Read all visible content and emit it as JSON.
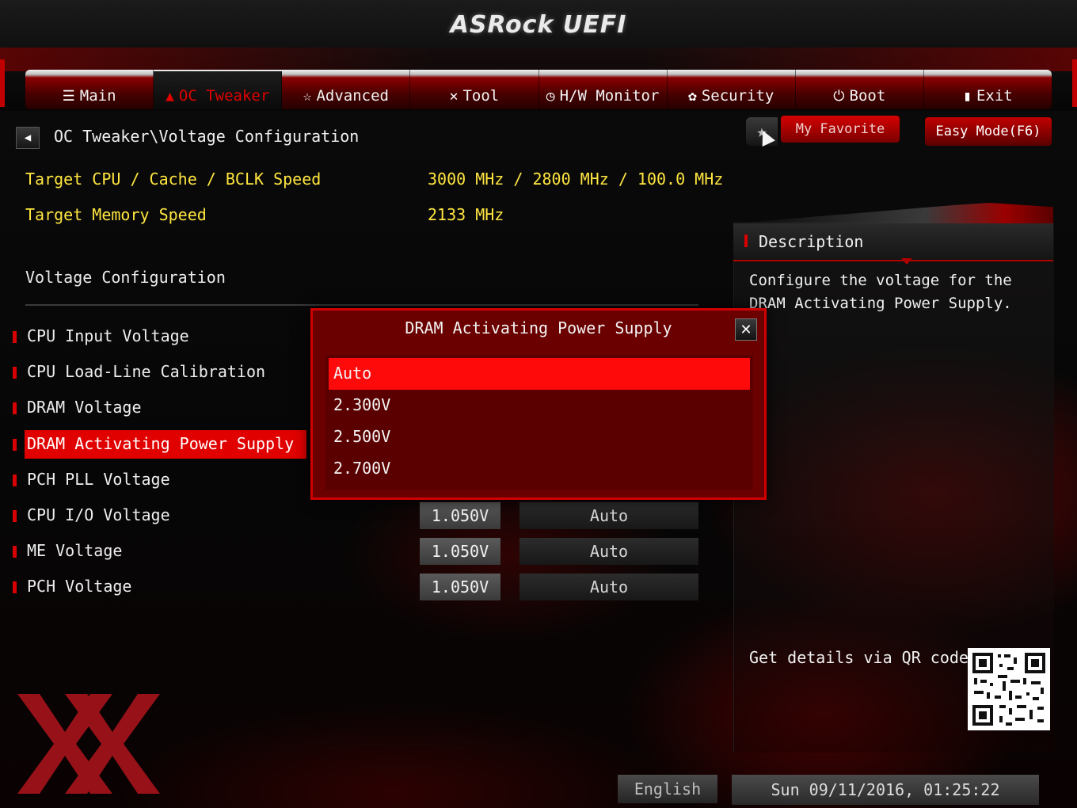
{
  "header": {
    "logo": "ASRock UEFI"
  },
  "tabs": [
    {
      "label": "Main",
      "icon": "list-icon",
      "glyph": "☰",
      "active": false
    },
    {
      "label": "OC Tweaker",
      "icon": "flame-icon",
      "glyph": "🔥",
      "active": true
    },
    {
      "label": "Advanced",
      "icon": "star-wand-icon",
      "glyph": "☆",
      "active": false
    },
    {
      "label": "Tool",
      "icon": "tools-icon",
      "glyph": "✕",
      "active": false
    },
    {
      "label": "H/W Monitor",
      "icon": "monitor-icon",
      "glyph": "◷",
      "active": false
    },
    {
      "label": "Security",
      "icon": "shield-icon",
      "glyph": "✿",
      "active": false
    },
    {
      "label": "Boot",
      "icon": "power-icon",
      "glyph": "⏻",
      "active": false
    },
    {
      "label": "Exit",
      "icon": "exit-icon",
      "glyph": "▮",
      "active": false
    }
  ],
  "breadcrumb": "OC Tweaker\\Voltage Configuration",
  "toolbar": {
    "favorite": "My Favorite",
    "easy_mode": "Easy Mode(F6)"
  },
  "info": {
    "cpu_label": "Target CPU / Cache / BCLK Speed",
    "cpu_value": "3000 MHz / 2800 MHz / 100.0 MHz",
    "mem_label": "Target Memory Speed",
    "mem_value": "2133 MHz"
  },
  "section_title": "Voltage Configuration",
  "menu": [
    {
      "label": "CPU Input Voltage"
    },
    {
      "label": "CPU Load-Line Calibration"
    },
    {
      "label": "DRAM Voltage"
    },
    {
      "label": "DRAM Activating Power Supply"
    },
    {
      "label": "PCH PLL Voltage"
    },
    {
      "label": "CPU I/O Voltage",
      "value": "1.050V",
      "mode": "Auto"
    },
    {
      "label": "ME Voltage",
      "value": "1.050V",
      "mode": "Auto"
    },
    {
      "label": "PCH Voltage",
      "value": "1.050V",
      "mode": "Auto"
    }
  ],
  "description": {
    "title": "Description",
    "text": "Configure the voltage for the DRAM Activating Power Supply.",
    "qr_label": "Get details via QR code"
  },
  "modal": {
    "title": "DRAM Activating Power Supply",
    "options": [
      "Auto",
      "2.300V",
      "2.500V",
      "2.700V"
    ],
    "selected_index": 0
  },
  "footer": {
    "language": "English",
    "datetime": "Sun 09/11/2016, 01:25:22"
  },
  "colors": {
    "accent": "#e00000",
    "highlight": "#ffe640",
    "modal_bg": "#6a0000"
  }
}
